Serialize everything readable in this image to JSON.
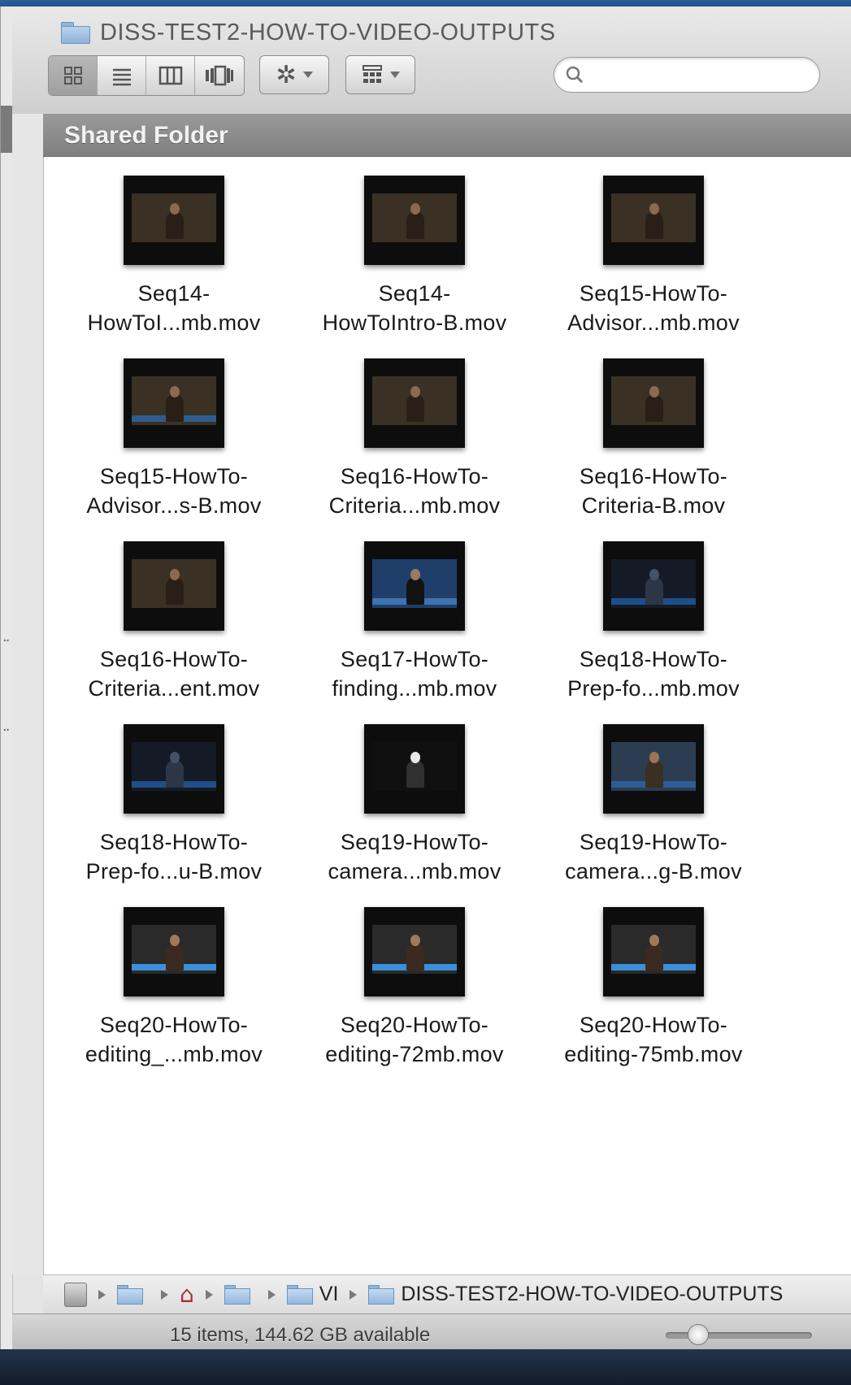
{
  "window": {
    "title": "DISS-TEST2-HOW-TO-VIDEO-OUTPUTS"
  },
  "toolbar": {
    "view_buttons": [
      "icon-view-icon",
      "list-view-icon",
      "column-view-icon",
      "coverflow-view-icon"
    ],
    "active_view": "icon-view",
    "action_menu_icon": "gear-icon",
    "arrange_menu_icon": "arrange-grid-icon",
    "search_value": ""
  },
  "section": {
    "title": "Shared Folder"
  },
  "files": [
    {
      "line1": "Seq14-",
      "line2": "HowToI...mb.mov",
      "thumb": "woman-office"
    },
    {
      "line1": "Seq14-",
      "line2": "HowToIntro-B.mov",
      "thumb": "woman-office"
    },
    {
      "line1": "Seq15-HowTo-",
      "line2": "Advisor...mb.mov",
      "thumb": "woman-office"
    },
    {
      "line1": "Seq15-HowTo-",
      "line2": "Advisor...s-B.mov",
      "thumb": "woman-office-blue"
    },
    {
      "line1": "Seq16-HowTo-",
      "line2": "Criteria...mb.mov",
      "thumb": "woman-office"
    },
    {
      "line1": "Seq16-HowTo-",
      "line2": "Criteria-B.mov",
      "thumb": "woman-office"
    },
    {
      "line1": "Seq16-HowTo-",
      "line2": "Criteria...ent.mov",
      "thumb": "woman-office"
    },
    {
      "line1": "Seq17-HowTo-",
      "line2": "finding...mb.mov",
      "thumb": "woman-blue"
    },
    {
      "line1": "Seq18-HowTo-",
      "line2": "Prep-fo...mb.mov",
      "thumb": "dark-room"
    },
    {
      "line1": "Seq18-HowTo-",
      "line2": "Prep-fo...u-B.mov",
      "thumb": "dark-room"
    },
    {
      "line1": "Seq19-HowTo-",
      "line2": "camera...mb.mov",
      "thumb": "dark-light"
    },
    {
      "line1": "Seq19-HowTo-",
      "line2": "camera...g-B.mov",
      "thumb": "man-blue"
    },
    {
      "line1": "Seq20-HowTo-",
      "line2": "editing_...mb.mov",
      "thumb": "man-monitor"
    },
    {
      "line1": "Seq20-HowTo-",
      "line2": "editing-72mb.mov",
      "thumb": "man-monitor"
    },
    {
      "line1": "Seq20-HowTo-",
      "line2": "editing-75mb.mov",
      "thumb": "man-monitor"
    }
  ],
  "pathbar": {
    "items": [
      "hard-disk-icon",
      "user-folder-icon",
      "home-icon",
      "folder-icon",
      "VI",
      "DISS-TEST2-HOW-TO-VIDEO-OUTPUTS"
    ],
    "truncated_label": "VI",
    "current_label": "DISS-TEST2-HOW-TO-VIDEO-OUTPUTS"
  },
  "status": {
    "text": "15 items, 144.62 GB available",
    "icon_size_fraction": 0.22
  },
  "colors": {
    "section_header": "#8a8a8a",
    "folder_blue": "#9dc0e6",
    "desktop": "#1b2a3d"
  }
}
